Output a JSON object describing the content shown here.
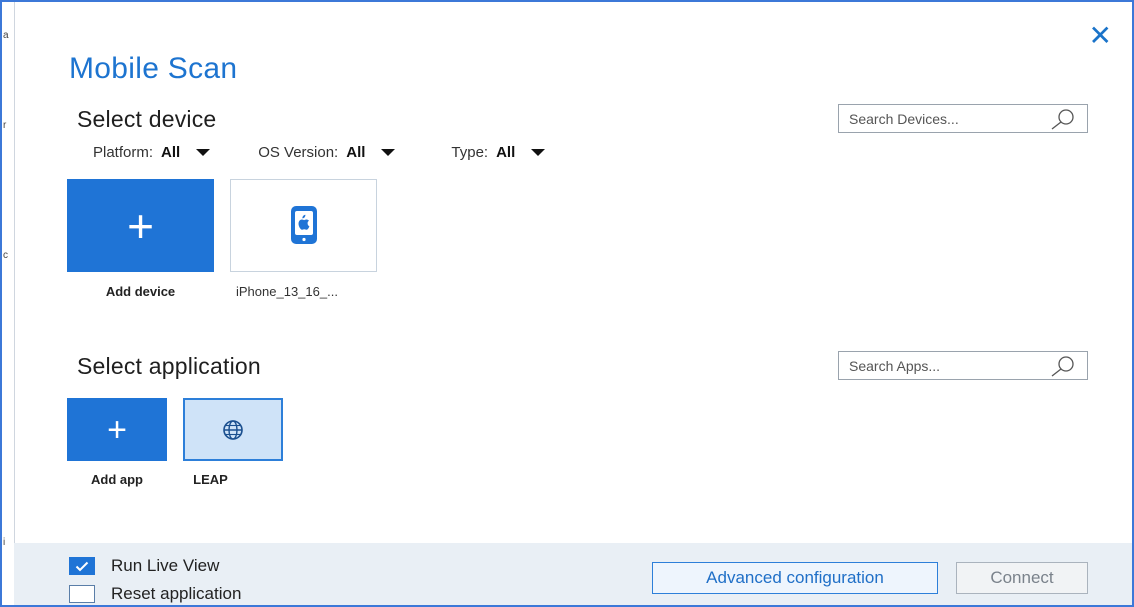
{
  "dialog": {
    "title": "Mobile Scan",
    "close_symbol": "✕"
  },
  "device_section": {
    "title": "Select device",
    "search_placeholder": "Search Devices...",
    "filters": [
      {
        "label": "Platform:",
        "value": "All"
      },
      {
        "label": "OS Version:",
        "value": "All"
      },
      {
        "label": "Type:",
        "value": "All"
      }
    ],
    "tiles": [
      {
        "label": "Add device",
        "icon": "plus-icon"
      },
      {
        "label": "iPhone_13_16_...",
        "icon": "apple-phone-icon"
      }
    ]
  },
  "app_section": {
    "title": "Select application",
    "search_placeholder": "Search Apps...",
    "tiles": [
      {
        "label": "Add app",
        "icon": "plus-icon"
      },
      {
        "label": "LEAP",
        "icon": "globe-icon"
      }
    ]
  },
  "footer": {
    "run_live_view": {
      "label": "Run Live View",
      "checked": true
    },
    "reset_application": {
      "label": "Reset application",
      "checked": false
    },
    "advanced_label": "Advanced configuration",
    "connect_label": "Connect"
  },
  "colors": {
    "accent": "#1f74d6",
    "title": "#1d74d0",
    "footer_bg": "#e9eff5",
    "selected_tile": "#cfe3f8"
  }
}
